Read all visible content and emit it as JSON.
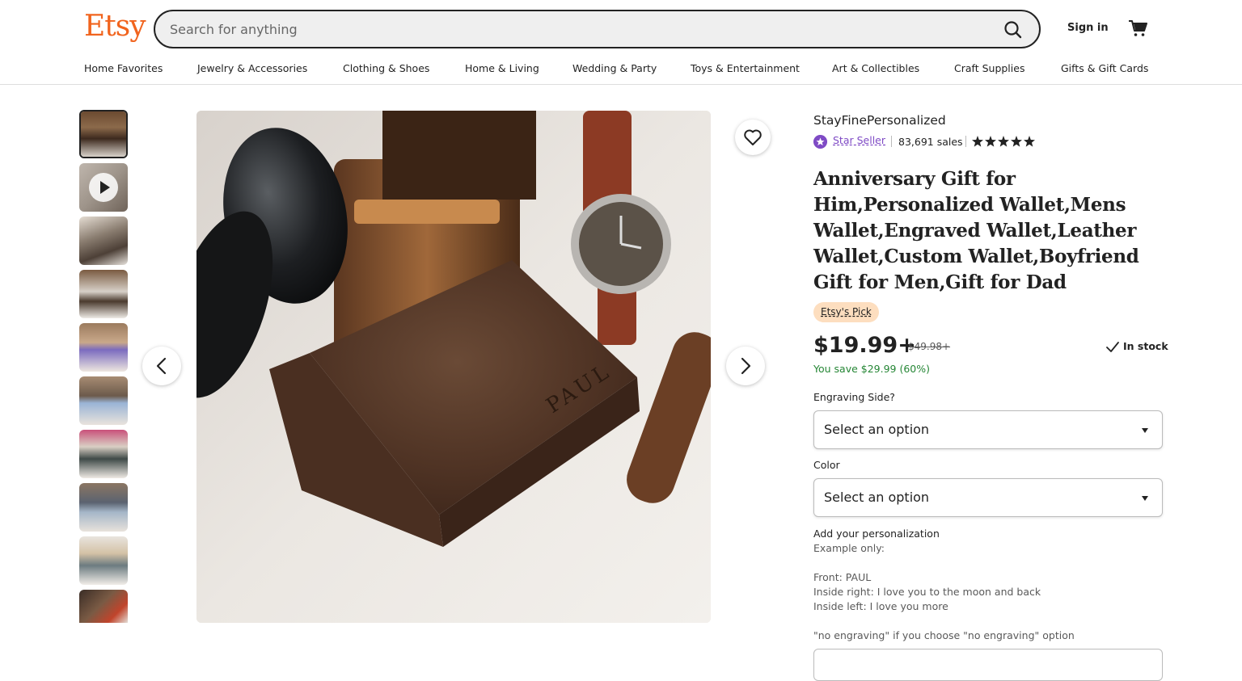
{
  "header": {
    "logo": "Etsy",
    "search_placeholder": "Search for anything",
    "sign_in": "Sign in"
  },
  "nav": [
    "Home Favorites",
    "Jewelry & Accessories",
    "Clothing & Shoes",
    "Home & Living",
    "Wedding & Party",
    "Toys & Entertainment",
    "Art & Collectibles",
    "Craft Supplies",
    "Gifts & Gift Cards"
  ],
  "gallery": {
    "thumbnail_count": 10,
    "active_index": 0,
    "video_index": 1,
    "main_image_engraving": "PAUL"
  },
  "product": {
    "shop_name": "StayFinePersonalized",
    "star_seller": "Star Seller",
    "sales": "83,691 sales",
    "rating": 5,
    "title": "Anniversary Gift for Him,Personalized Wallet,Mens Wallet,Engraved Wallet,Leather Wallet,Custom Wallet,Boyfriend Gift for Men,Gift for Dad",
    "badge": "Etsy's Pick",
    "price": "$19.99+",
    "original_price": "$49.98+",
    "stock": "In stock",
    "savings": "You save $29.99 (60%)"
  },
  "options": [
    {
      "label": "Engraving Side?",
      "value": "Select an option"
    },
    {
      "label": "Color",
      "value": "Select an option"
    }
  ],
  "personalization": {
    "title": "Add your personalization",
    "lines": [
      "Example only:",
      "",
      "Front: PAUL",
      "Inside right: I love you to the moon and back",
      "Inside left: I love you more",
      "",
      "\"no engraving\" if you choose \"no engraving\" option"
    ]
  },
  "colors": {
    "brand": "#f1641e",
    "star_seller": "#7f4bc5",
    "savings": "#258635",
    "pick_badge": "#fddebf"
  }
}
